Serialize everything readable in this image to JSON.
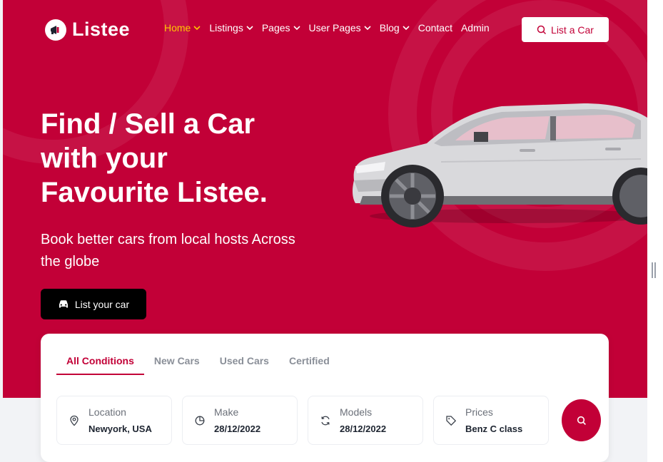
{
  "brand": {
    "name": "Listee",
    "accent": "#c20037",
    "nav_active": "#ffc700"
  },
  "nav": {
    "items": [
      {
        "label": "Home",
        "dropdown": true,
        "active": true
      },
      {
        "label": "Listings",
        "dropdown": true
      },
      {
        "label": "Pages",
        "dropdown": true
      },
      {
        "label": "User Pages",
        "dropdown": true
      },
      {
        "label": "Blog",
        "dropdown": true
      },
      {
        "label": "Contact",
        "dropdown": false
      },
      {
        "label": "Admin",
        "dropdown": false
      }
    ],
    "cta_label": "List a Car",
    "cta_icon": "search-icon"
  },
  "hero": {
    "headline_lines": [
      "Find / Sell a Car",
      "with your",
      "Favourite Listee."
    ],
    "subtitle": "Book better cars from local hosts Across the globe",
    "cta_label": "List your car",
    "cta_icon": "car-icon"
  },
  "search": {
    "tabs": [
      "All Conditions",
      "New Cars",
      "Used Cars",
      "Certified"
    ],
    "active_tab": "All Conditions",
    "fields": [
      {
        "label": "Location",
        "value": "Newyork, USA",
        "icon": "map-pin-icon"
      },
      {
        "label": "Make",
        "value": "28/12/2022",
        "icon": "pie-chart-icon"
      },
      {
        "label": "Models",
        "value": "28/12/2022",
        "icon": "refresh-icon"
      },
      {
        "label": "Prices",
        "value": "Benz C class",
        "icon": "tag-icon"
      }
    ],
    "button_icon": "search-icon"
  }
}
